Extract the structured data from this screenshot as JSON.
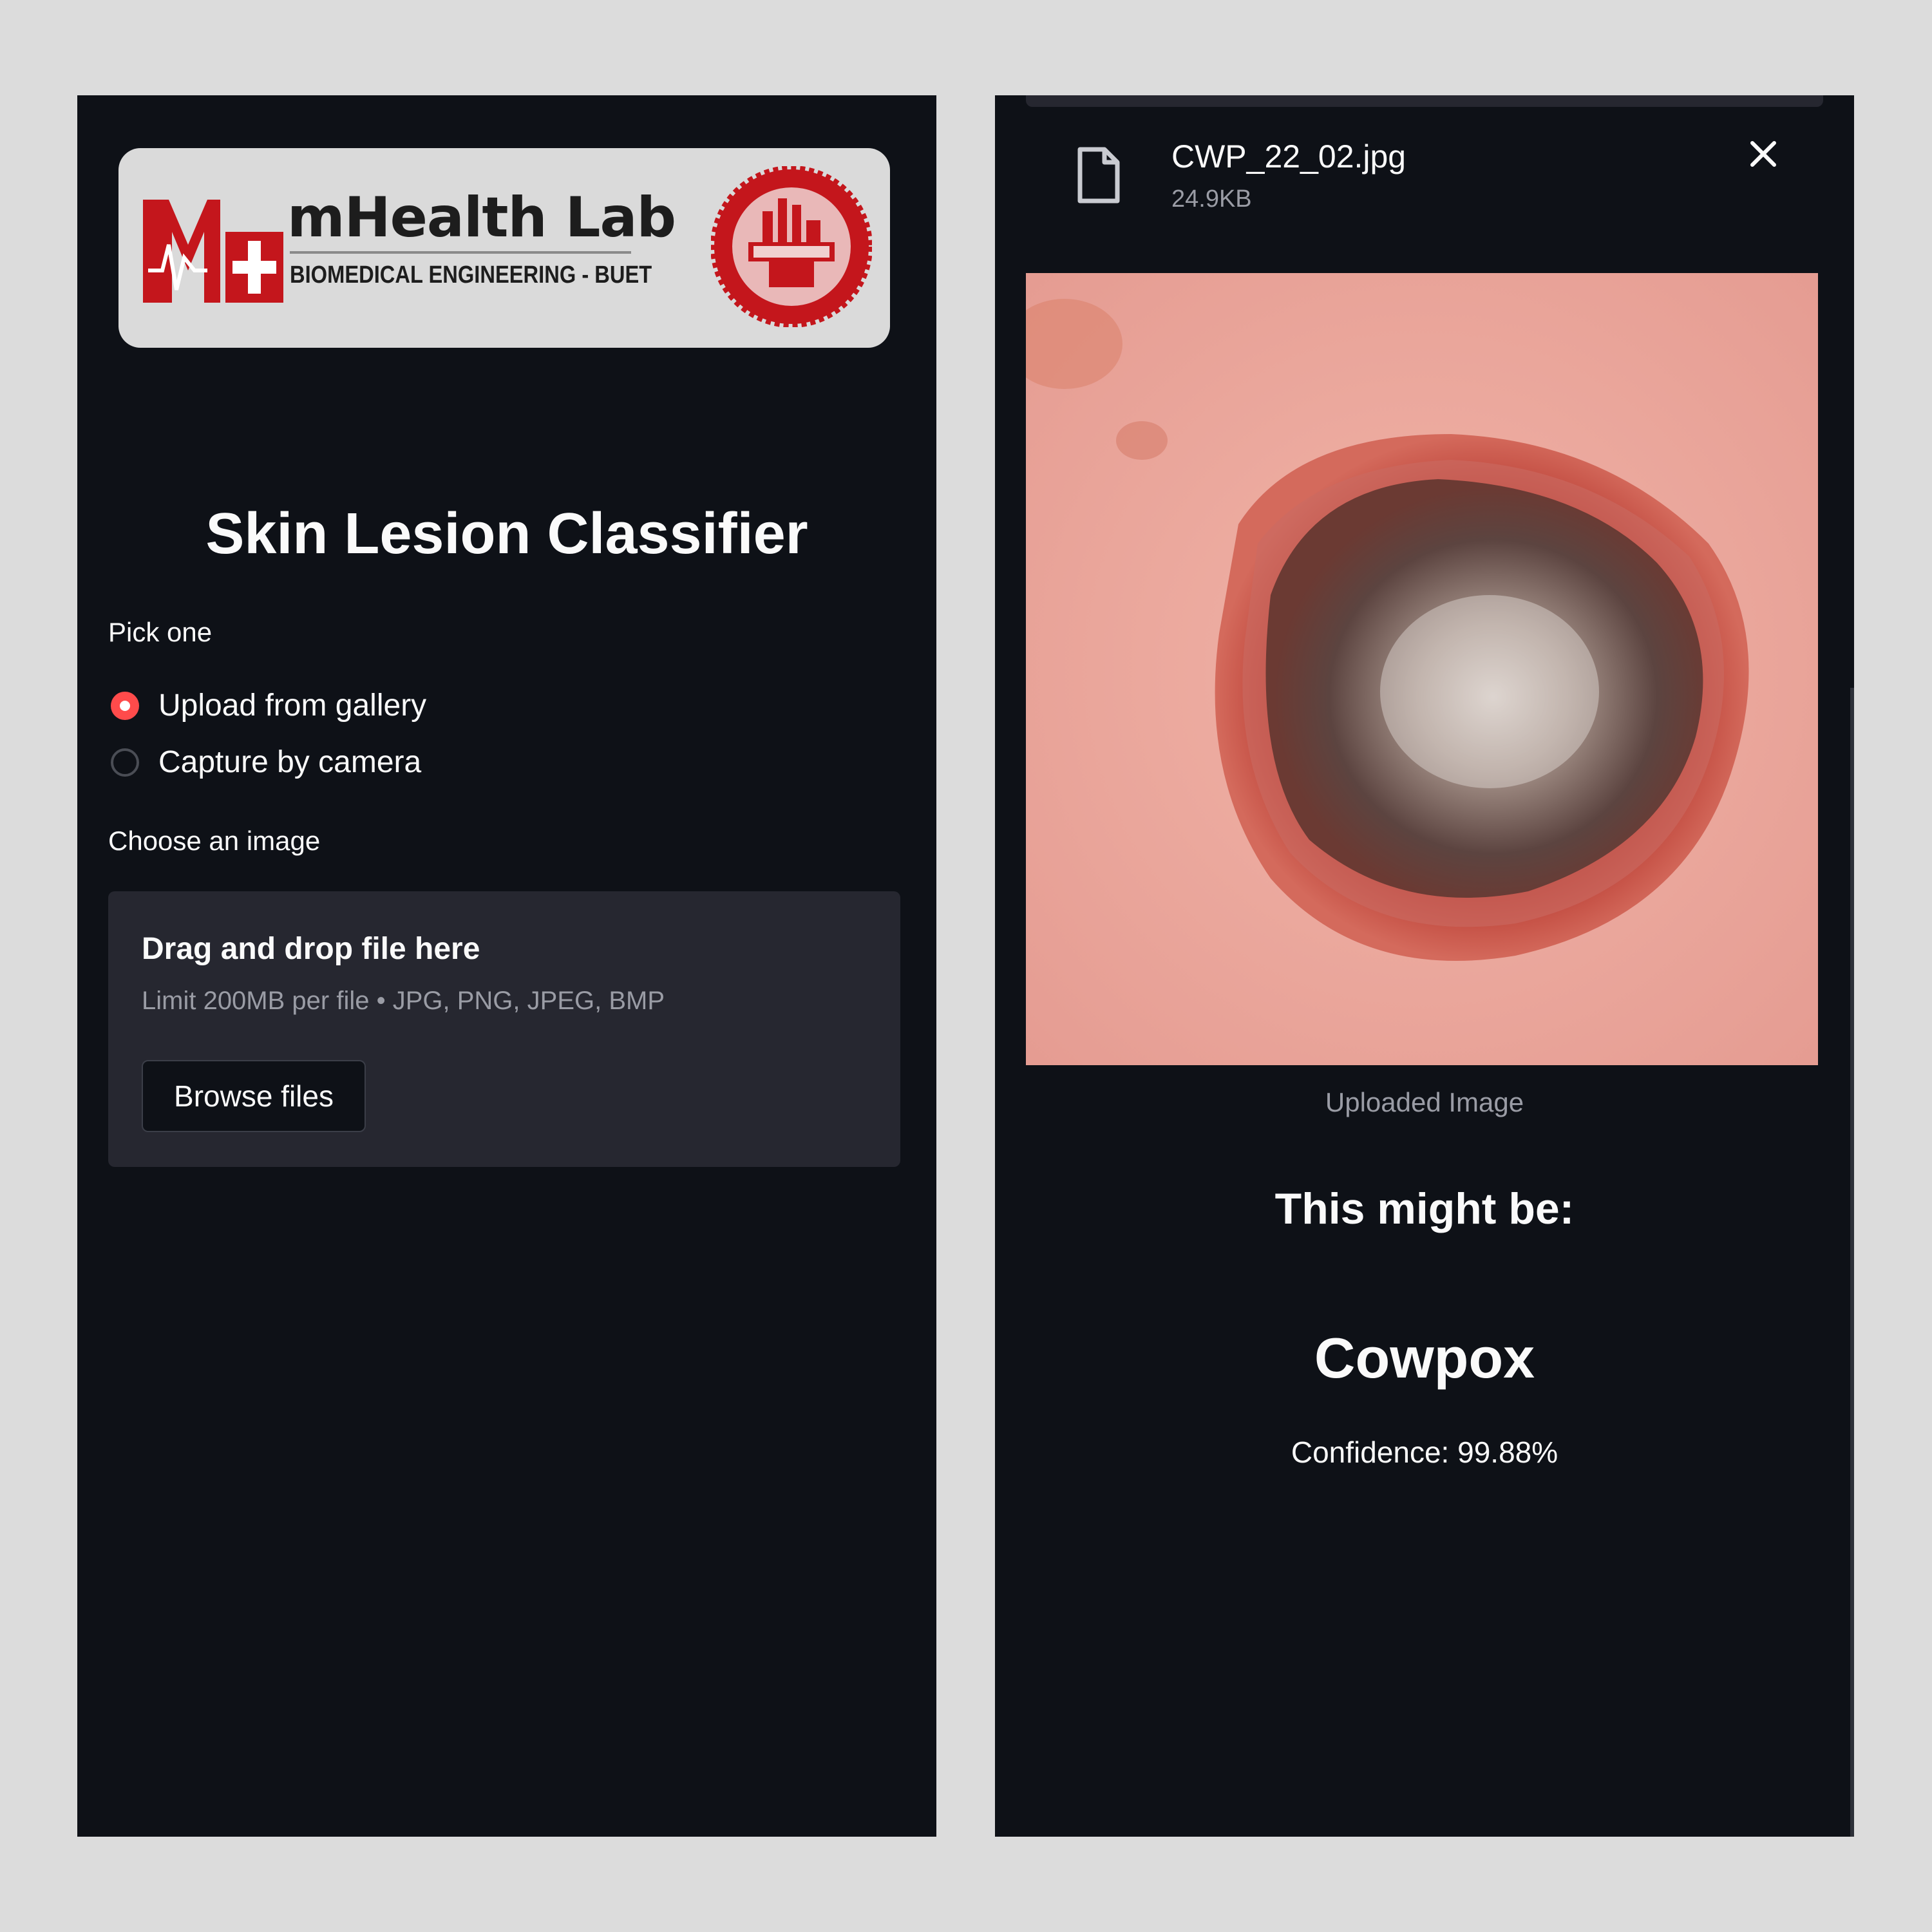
{
  "logo": {
    "title": "mHealth Lab",
    "subtitle": "BIOMEDICAL ENGINEERING - BUET",
    "brand_color": "#c4161c"
  },
  "app": {
    "title": "Skin Lesion Classifier",
    "accent_color": "#ff4b4b"
  },
  "input_mode": {
    "label": "Pick one",
    "options": [
      {
        "label": "Upload from gallery",
        "selected": true
      },
      {
        "label": "Capture by camera",
        "selected": false
      }
    ]
  },
  "uploader": {
    "label": "Choose an image",
    "drop_text": "Drag and drop file here",
    "limit_text": "Limit 200MB per file • JPG, PNG, JPEG, BMP",
    "browse_label": "Browse files"
  },
  "uploaded_file": {
    "name": "CWP_22_02.jpg",
    "size": "24.9KB",
    "icon": "file-icon",
    "remove_icon": "close-icon"
  },
  "preview": {
    "caption": "Uploaded Image"
  },
  "result": {
    "heading": "This might be:",
    "prediction": "Cowpox",
    "confidence_text": "Confidence: 99.88%"
  }
}
